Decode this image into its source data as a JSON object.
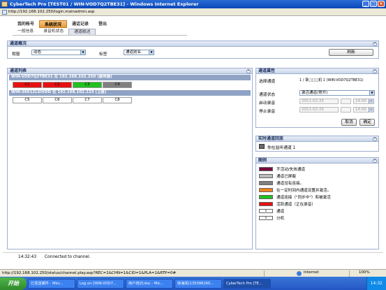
{
  "window": {
    "title": "CyberTech Pro [TEST01 / WIN-VOD7Q2TBE31] - Windows Internet Explorer",
    "address": "http://192.168.102.250/login.mainadmin.asp"
  },
  "nav": {
    "tabs": [
      "我的帐号",
      "系统状况",
      "通话记录",
      "登出"
    ],
    "active_index": 1,
    "subtabs": [
      "一般信息",
      "录音机状态",
      "通道概述"
    ],
    "active_sub_index": 2
  },
  "overview": {
    "title": "通道概况",
    "view_label": "视窗",
    "view_value": "动态",
    "tag_label": "标签",
    "tag_value": "通道别名",
    "refresh_label": "刷新"
  },
  "channel_list": {
    "title": "通道列表",
    "groups": [
      {
        "label": "WIN-VOD7Q2TBE31 在 192.168.102.250 (服务器)",
        "cells": [
          "C1",
          "C2",
          "C3",
          "C4"
        ],
        "colors": [
          "#e81010",
          "#e81010",
          "#22c020",
          "#808080"
        ]
      },
      {
        "label": "WIN-36612LSIVDD 在 192.168.102.133 (卫星)",
        "cells": [
          "C5",
          "C6",
          "C7",
          "C8"
        ],
        "colors": [
          "#ffffff",
          "#ffffff",
          "#ffffff",
          "#ffffff"
        ]
      }
    ]
  },
  "properties": {
    "title": "通道属性",
    "select_label": "选择通道",
    "select_value": "1 / 录□□□机 1 (WIN-VOD7Q2TBE31)",
    "state_label": "通道状态",
    "state_value": "激活通道(常开)",
    "start_label": "启动录音",
    "start_date": "2011-02-25",
    "start_time": "14:00",
    "stop_label": "停止录音",
    "stop_date": "2011-02-25",
    "stop_time": "14:00",
    "cancel_label": "取消",
    "ok_label": "确定"
  },
  "realtime": {
    "title": "实时通道回放",
    "text": "你在监听通道 1"
  },
  "legend": {
    "title": "图例",
    "items": [
      {
        "color": "#7a0a3a",
        "text": "不活动/失效通道"
      },
      {
        "color": "#bbbbbb",
        "text": "通道已屏蔽"
      },
      {
        "color": "#808080",
        "text": "通道没有连接。"
      },
      {
        "color": "#f08020",
        "text": "在一定时间内通道设置并激活。"
      },
      {
        "color": "#22c020",
        "text": "通道连接（\"同步中\"）和被激活"
      },
      {
        "color": "#e81010",
        "text": "活跃通道（正在录音）"
      },
      {
        "color": "#ffffff",
        "text": "通道",
        "mark": "n"
      },
      {
        "color": "#ffffff",
        "text": "分机",
        "mark": "n"
      }
    ]
  },
  "status": {
    "time": "14:32:43",
    "message": "Connected to channel."
  },
  "ie_status": {
    "url": "http://192.168.102.250/status/channel.play.asp?REC=1&CHN=1&CID=1&PLA=1&RTP=0#",
    "zone": "Internet",
    "zoom": "100%"
  },
  "taskbar": {
    "start": "开始",
    "tasks": [
      "已发送邮件 - Micr...",
      "Log on [WIN-VOD7...",
      "用户培训.doc - Mic...",
      "徐海闻(135096160...",
      "CyberTech Pro [TE..."
    ],
    "active_index": 4,
    "clock": "14:32"
  }
}
